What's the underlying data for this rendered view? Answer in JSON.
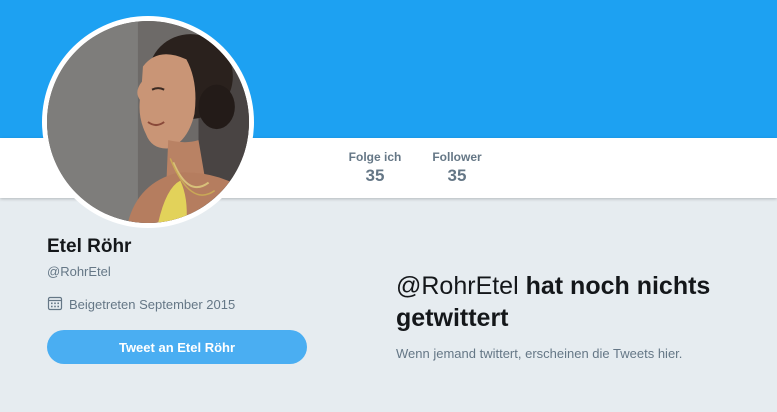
{
  "header": {
    "banner_color": "#1da1f2"
  },
  "profile": {
    "name": "Etel Röhr",
    "handle": "@RohrEtel",
    "joined": "Beigetreten September 2015",
    "joined_icon": "calendar-icon",
    "tweet_button_label": "Tweet an Etel Röhr"
  },
  "stats": [
    {
      "label": "Folge ich",
      "value": "35"
    },
    {
      "label": "Follower",
      "value": "35"
    }
  ],
  "timeline": {
    "empty_heading_handle": "@RohrEtel",
    "empty_heading_rest": " hat noch nichts getwittert",
    "empty_text": "Wenn jemand twittert, erscheinen die Tweets hier."
  },
  "colors": {
    "accent": "#1da1f2",
    "button": "#4aaef2",
    "secondary_text": "#657786",
    "page_background": "#e6ecf0"
  }
}
